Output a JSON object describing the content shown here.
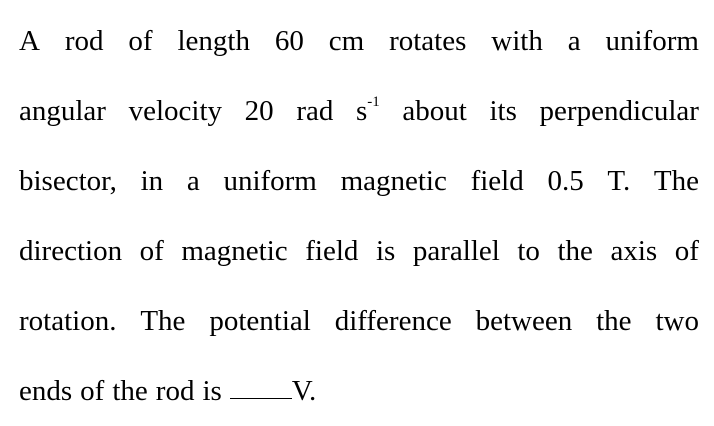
{
  "question": {
    "line1": [
      "A",
      "rod",
      "of",
      "length",
      "60",
      "cm",
      "rotates",
      "with",
      "a",
      "uniform"
    ],
    "line2_pre": [
      "angular",
      "velocity",
      "20",
      "rad"
    ],
    "line2_unit": "s",
    "line2_exp": "-1",
    "line2_post": [
      "about",
      "its",
      "perpendicular"
    ],
    "line3": [
      "bisector,",
      "in",
      "a",
      "uniform",
      "magnetic",
      "field",
      "0.5",
      "T.",
      "The"
    ],
    "line4": [
      "direction",
      "of",
      "magnetic",
      "field",
      "is",
      "parallel",
      "to",
      "the",
      "axis",
      "of"
    ],
    "line5": [
      "rotation.",
      "The",
      "potential",
      "difference",
      "between",
      "the",
      "two"
    ],
    "line6_pre": [
      "ends",
      "of",
      "the",
      "rod",
      "is"
    ],
    "line6_post": "V."
  }
}
